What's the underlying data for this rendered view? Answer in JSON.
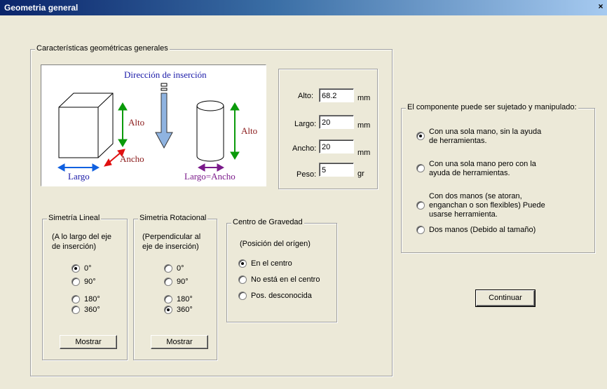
{
  "window": {
    "title": "Geometria general",
    "close": "×"
  },
  "caracteristicas": {
    "legend": "Características geométricas generales",
    "illustration": {
      "insertion": "Dirección de inserción",
      "alto_left": "Alto",
      "alto_right": "Alto",
      "ancho": "Ancho",
      "largo": "Largo",
      "largo_ancho": "Largo=Ancho"
    },
    "dims": {
      "alto_label": "Alto:",
      "alto_value": "68.2",
      "alto_unit": "mm",
      "largo_label": "Largo:",
      "largo_value": "20",
      "largo_unit": "mm",
      "ancho_label": "Ancho:",
      "ancho_value": "20",
      "ancho_unit": "mm",
      "peso_label": "Peso:",
      "peso_value": "5",
      "peso_unit": "gr"
    },
    "simetria_lineal": {
      "legend": "Simetría Lineal",
      "desc1": "(A lo largo del eje",
      "desc2": "de inserción)",
      "options": [
        "0°",
        "90°",
        "180°",
        "360°"
      ],
      "selected": "0°",
      "button": "Mostrar"
    },
    "simetria_rotacional": {
      "legend": "Simetria Rotacional",
      "desc1": "(Perpendicular al",
      "desc2": "eje de inserción)",
      "options": [
        "0°",
        "90°",
        "180°",
        "360°"
      ],
      "selected": "360°",
      "button": "Mostrar"
    },
    "centro_gravedad": {
      "legend": "Centro de Gravedad",
      "desc": "(Posición del orígen)",
      "options": [
        "En el centro",
        "No está en el centro",
        "Pos. desconocida"
      ],
      "selected": "En el centro"
    }
  },
  "sujecion": {
    "legend": "El componente puede ser sujetado y manipulado:",
    "options": [
      [
        "Con una sola mano, sin la ayuda",
        "de herramientas."
      ],
      [
        "Con una sola mano pero con la",
        "ayuda de herramientas."
      ],
      [
        "Con dos manos (se atoran,",
        "enganchan o son flexibles) Puede",
        "usarse herramienta."
      ],
      [
        "Dos manos (Debido al tamaño)"
      ]
    ],
    "selected": 0
  },
  "continuar": "Continuar",
  "colors": {
    "insertion_text": "#1a1aa8",
    "alto_arrow": "#0a9a0a",
    "ancho_arrow": "#e01010",
    "largo_arrow": "#1060e0",
    "largo_ancho_text": "#7a1a8a",
    "dimension_text": "#8a1a1a"
  }
}
